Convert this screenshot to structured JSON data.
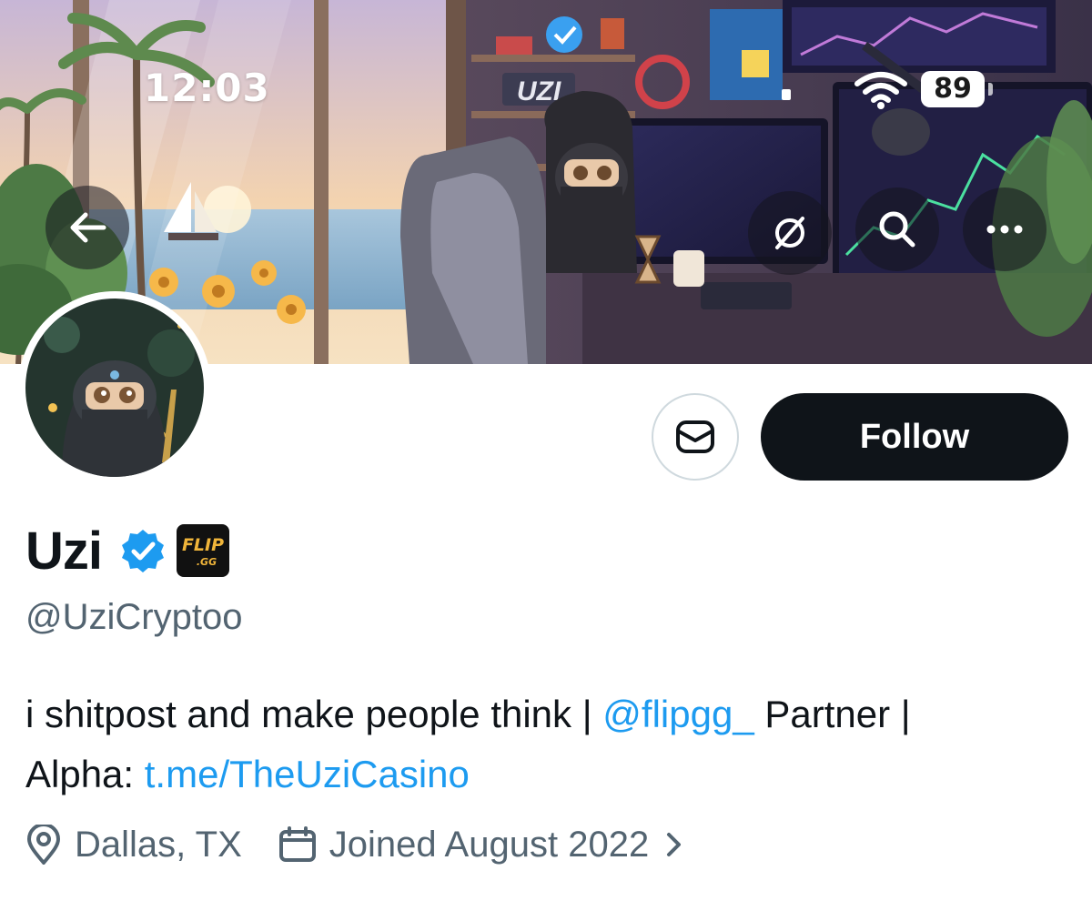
{
  "status_bar": {
    "time": "12:03",
    "battery": "89"
  },
  "banner": {
    "description_icons": [
      "back-arrow-icon",
      "grok-icon",
      "search-icon",
      "more-icon"
    ],
    "sign_text": "UZI"
  },
  "profile": {
    "display_name": "Uzi",
    "handle": "@UziCryptoo",
    "verified": true,
    "affiliate_badge_text": "FLIP .GG",
    "bio": {
      "line1_text": "i shitpost and make people think | ",
      "mention": "@flipgg_",
      "line1_tail": " Partner |",
      "line2_prefix": "Alpha: ",
      "link": "t.me/TheUziCasino"
    },
    "location": "Dallas, TX",
    "joined": "Joined August 2022"
  },
  "actions": {
    "follow_label": "Follow"
  },
  "colors": {
    "link": "#1d9bf0",
    "text": "#0f1419",
    "secondary": "#536471",
    "follow_bg": "#0f1419",
    "verified": "#1d9bf0"
  }
}
